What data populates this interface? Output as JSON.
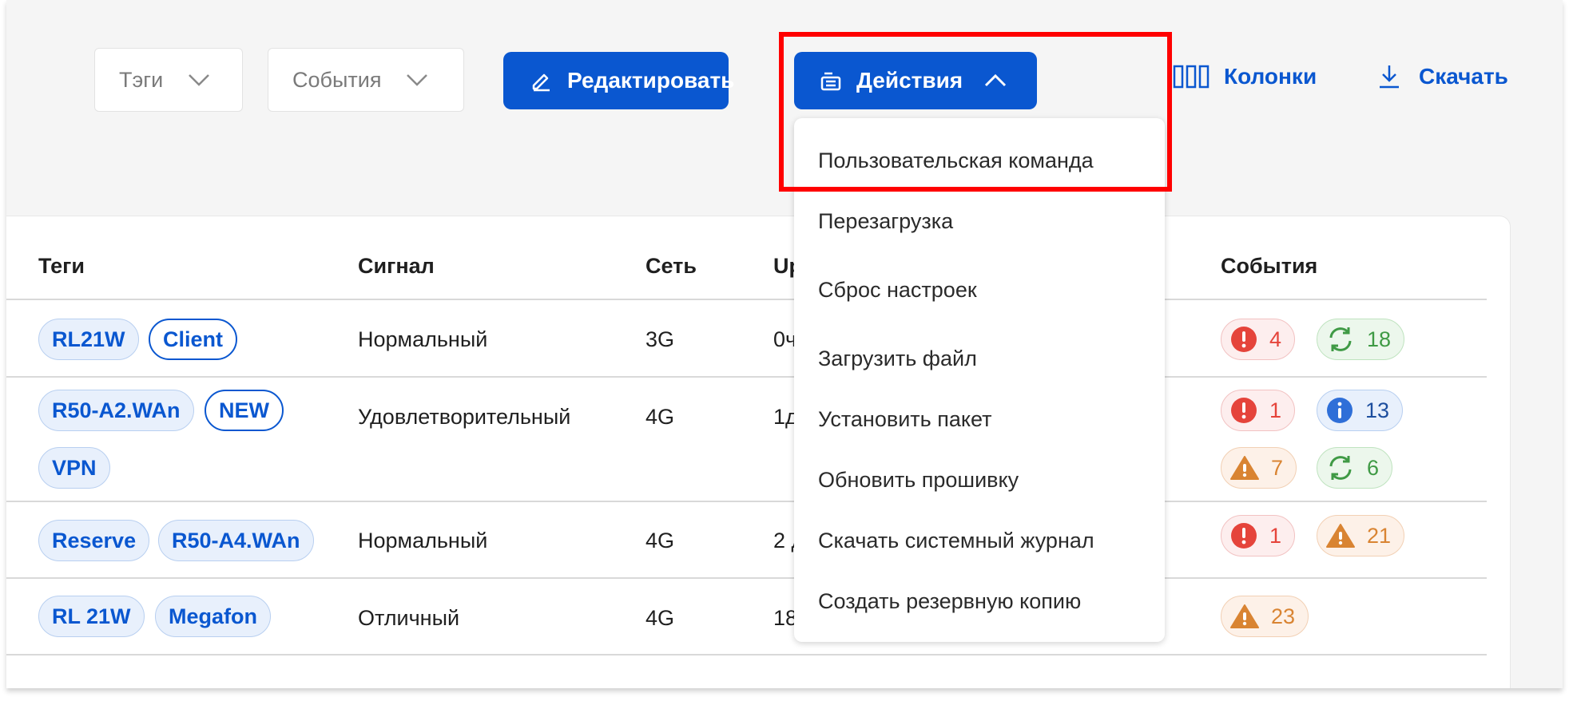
{
  "toolbar": {
    "filter_tags": "Тэги",
    "filter_events": "События",
    "edit_label": "Редактировать",
    "actions_label": "Действия",
    "columns_label": "Колонки",
    "download_label": "Скачать"
  },
  "actions_menu": {
    "items": [
      "Пользовательская команда",
      "Перезагрузка",
      "Сброс настроек",
      "Загрузить файл",
      "Установить пакет",
      "Обновить прошивку",
      "Скачать системный журнал",
      "Создать резервную копию"
    ]
  },
  "table": {
    "headers": {
      "tags": "Теги",
      "signal": "Сигнал",
      "network": "Сеть",
      "uptime": "Up",
      "events": "События"
    },
    "rows": [
      {
        "tags": [
          "RL21W",
          "Client"
        ],
        "signal": "Нормальный",
        "network": "3G",
        "uptime": "0ч",
        "events": [
          {
            "type": "error",
            "count": "4"
          },
          {
            "type": "sync",
            "count": "18"
          }
        ]
      },
      {
        "tags": [
          "R50-A2.WAn",
          "NEW",
          "VPN"
        ],
        "signal": "Удовлетворительный",
        "network": "4G",
        "uptime": "1д",
        "events": [
          {
            "type": "error",
            "count": "1"
          },
          {
            "type": "info",
            "count": "13"
          },
          {
            "type": "warning",
            "count": "7"
          },
          {
            "type": "sync",
            "count": "6"
          }
        ]
      },
      {
        "tags": [
          "Reserve",
          "R50-A4.WAn"
        ],
        "signal": "Нормальный",
        "network": "4G",
        "uptime": "2 д",
        "events": [
          {
            "type": "error",
            "count": "1"
          },
          {
            "type": "warning",
            "count": "21"
          }
        ]
      },
      {
        "tags": [
          "RL 21W",
          "Megafon"
        ],
        "signal": "Отличный",
        "network": "4G",
        "uptime": "18",
        "events": [
          {
            "type": "warning",
            "count": "23"
          }
        ]
      }
    ]
  },
  "colors": {
    "primary": "#0a57d0",
    "error": "#e5443b",
    "success": "#3f9a45",
    "info": "#1d4e9e",
    "warning": "#d98432",
    "highlight": "#ff0000"
  }
}
